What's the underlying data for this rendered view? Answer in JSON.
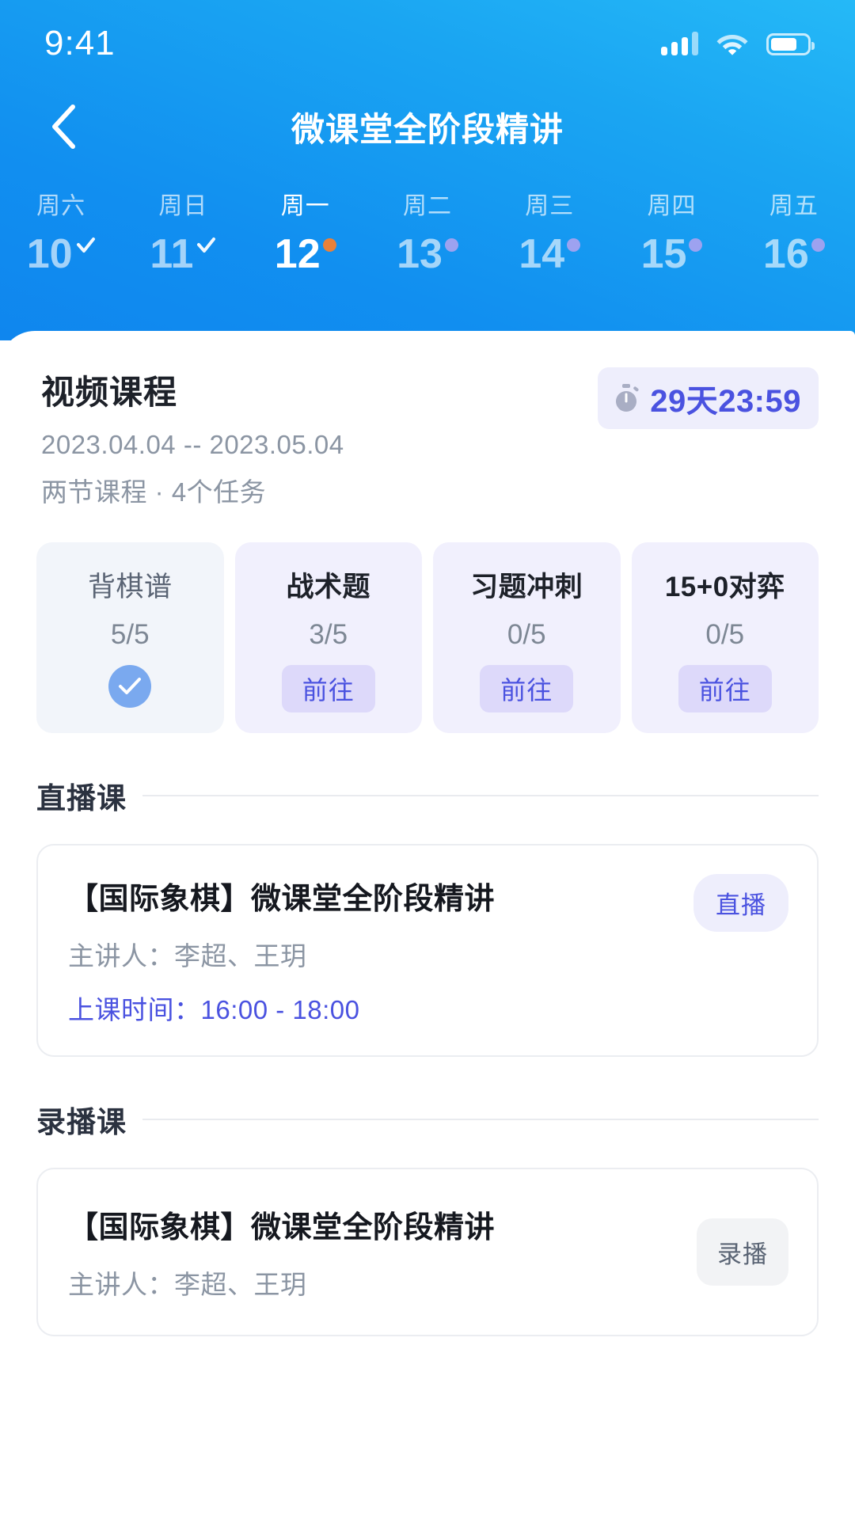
{
  "statusbar": {
    "time": "9:41",
    "signal_icon": "signal-bars-icon",
    "wifi_icon": "wifi-icon",
    "battery_icon": "battery-icon"
  },
  "navbar": {
    "back_icon": "chevron-left-icon",
    "title": "微课堂全阶段精讲"
  },
  "date_strip": {
    "days": [
      {
        "dow": "周六",
        "num": "10",
        "mark": "check",
        "active": false
      },
      {
        "dow": "周日",
        "num": "11",
        "mark": "check",
        "active": false
      },
      {
        "dow": "周一",
        "num": "12",
        "mark": "dot-today",
        "active": true
      },
      {
        "dow": "周二",
        "num": "13",
        "mark": "dot-future",
        "active": false
      },
      {
        "dow": "周三",
        "num": "14",
        "mark": "dot-future",
        "active": false
      },
      {
        "dow": "周四",
        "num": "15",
        "mark": "dot-future",
        "active": false
      },
      {
        "dow": "周五",
        "num": "16",
        "mark": "dot-future",
        "active": false
      }
    ]
  },
  "course": {
    "title": "视频课程",
    "date_range": "2023.04.04 -- 2023.05.04",
    "meta": "两节课程 · 4个任务",
    "countdown": {
      "icon": "stopwatch-icon",
      "text": "29天23:59"
    }
  },
  "tasks": [
    {
      "name": "背棋谱",
      "progress": "5/5",
      "state": "done",
      "action_label": "",
      "check_icon": "check-circle-icon"
    },
    {
      "name": "战术题",
      "progress": "3/5",
      "state": "pending",
      "action_label": "前往"
    },
    {
      "name": "习题冲刺",
      "progress": "0/5",
      "state": "pending",
      "action_label": "前往"
    },
    {
      "name": "15+0对弈",
      "progress": "0/5",
      "state": "pending",
      "action_label": "前往"
    }
  ],
  "sections": [
    {
      "title": "直播课",
      "lesson": {
        "title": "【国际象棋】微课堂全阶段精讲",
        "teacher": "主讲人：李超、王玥",
        "time": "上课时间：16:00 - 18:00",
        "badge": "直播"
      }
    },
    {
      "title": "录播课",
      "lesson": {
        "title": "【国际象棋】微课堂全阶段精讲",
        "teacher": "主讲人：李超、王玥",
        "time": "",
        "badge": "录播"
      }
    }
  ],
  "colors": {
    "header_gradient_start": "#25b9f7",
    "header_gradient_end": "#0f86ee",
    "accent_purple": "#4a52e0",
    "badge_bg": "#eeeefc",
    "today_dot": "#e8813a",
    "future_dot": "#9da2f0",
    "check_circle": "#7aa9ef"
  }
}
